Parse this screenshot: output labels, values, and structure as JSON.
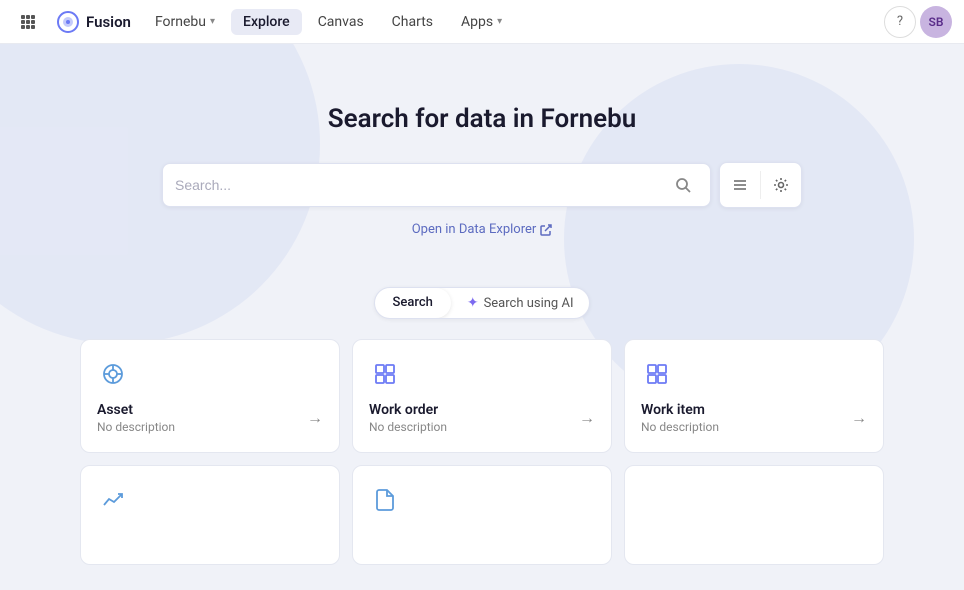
{
  "navbar": {
    "logo_text": "Fusion",
    "items": [
      {
        "label": "Fornebu",
        "has_chevron": true,
        "active": false,
        "id": "fornebu"
      },
      {
        "label": "Explore",
        "has_chevron": false,
        "active": true,
        "id": "explore"
      },
      {
        "label": "Canvas",
        "has_chevron": false,
        "active": false,
        "id": "canvas"
      },
      {
        "label": "Charts",
        "has_chevron": false,
        "active": false,
        "id": "charts"
      },
      {
        "label": "Apps",
        "has_chevron": true,
        "active": false,
        "id": "apps"
      }
    ],
    "avatar_text": "SB",
    "help_icon": "?"
  },
  "main": {
    "search_title": "Search for data in Fornebu",
    "search_placeholder": "Search...",
    "data_explorer_label": "Open in Data Explorer",
    "tabs": [
      {
        "label": "Search",
        "active": true
      },
      {
        "label": "Search using AI",
        "active": false,
        "has_ai_icon": true
      }
    ]
  },
  "cards": {
    "row1": [
      {
        "id": "asset",
        "title": "Asset",
        "desc": "No description",
        "icon": "asset"
      },
      {
        "id": "work-order",
        "title": "Work order",
        "desc": "No description",
        "icon": "workorder"
      },
      {
        "id": "work-item",
        "title": "Work item",
        "desc": "No description",
        "icon": "workitem"
      }
    ],
    "row2": [
      {
        "id": "trend",
        "title": "",
        "desc": "",
        "icon": "trend"
      },
      {
        "id": "document",
        "title": "",
        "desc": "",
        "icon": "document"
      },
      {
        "id": "empty3",
        "title": "",
        "desc": "",
        "icon": ""
      }
    ]
  }
}
